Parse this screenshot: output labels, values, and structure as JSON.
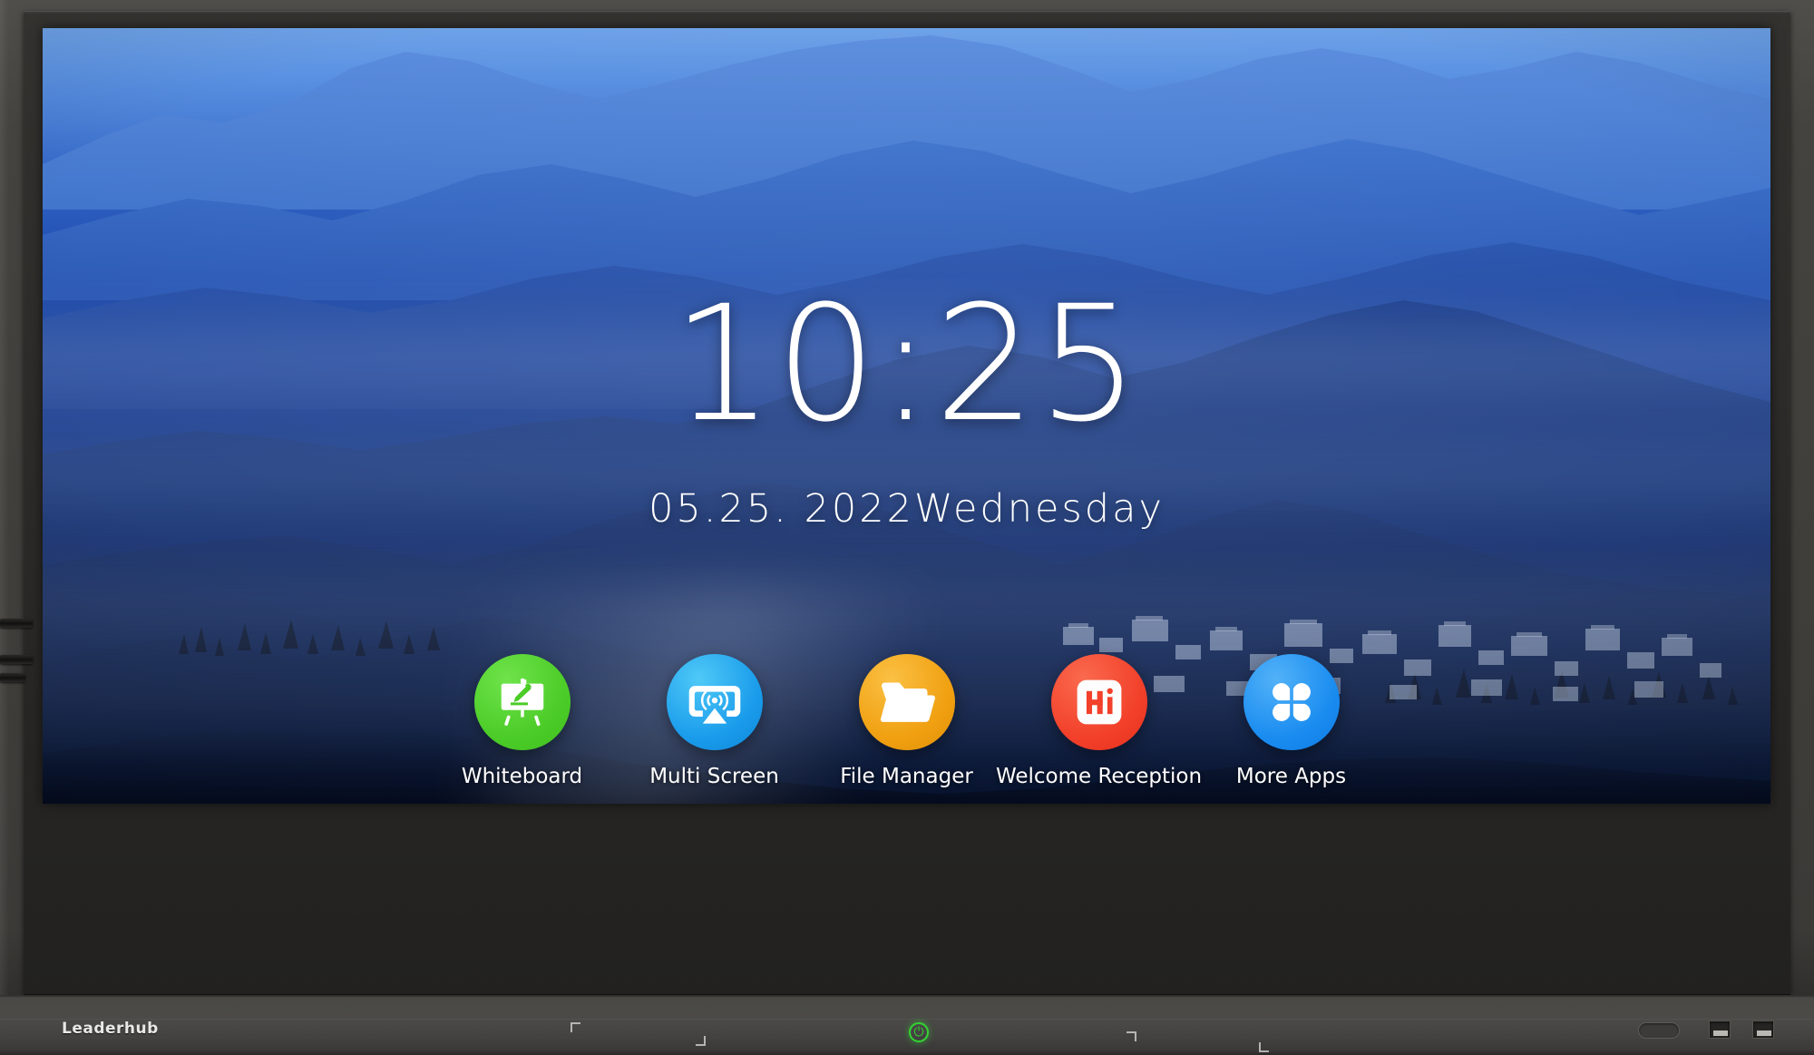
{
  "device": {
    "brand": "Leaderhub",
    "bezel_color": "#45433f",
    "power_led_color": "#32d432"
  },
  "screen": {
    "clock": "10:25",
    "date": "05.25. 2022Wednesday",
    "wallpaper_description": "layered misty blue mountains with village at dusk",
    "wallpaper_colors": {
      "sky_top": "#6ea2e8",
      "sky_mid": "#2352b4",
      "ridge_far": "#3f73c8",
      "ridge_mid": "#1f4a9e",
      "ridge_near": "#132f6b",
      "foreground": "#0a1430",
      "fog": "#bacdee"
    }
  },
  "dock": {
    "apps": [
      {
        "label": "Whiteboard",
        "icon": "whiteboard-easel-icon",
        "color": "#4ccc28",
        "color2": "#6ee34a"
      },
      {
        "label": "Multi Screen",
        "icon": "screen-cast-icon",
        "color": "#1a9ceb",
        "color2": "#3fc3f5"
      },
      {
        "label": "File Manager",
        "icon": "open-folder-icon",
        "color": "#f0a011",
        "color2": "#fbc043"
      },
      {
        "label": "Welcome Reception",
        "icon": "hi-greeting-icon",
        "color": "#f2402a",
        "color2": "#fa6a4e"
      },
      {
        "label": "More Apps",
        "icon": "grid-apps-icon",
        "color": "#1a8cf0",
        "color2": "#46aaf7"
      }
    ]
  },
  "bezel": {
    "power_glyph": "⏻",
    "usb_ports": 2,
    "side_ports": 3,
    "corner_marks": 4
  }
}
